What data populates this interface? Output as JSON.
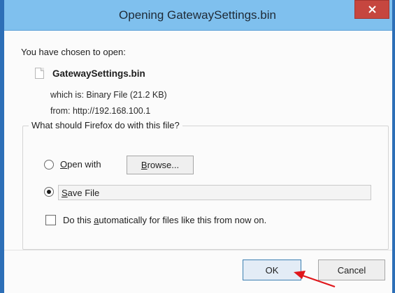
{
  "dialog": {
    "title": "Opening GatewaySettings.bin",
    "close_icon": "close-icon",
    "intro": "You have chosen to open:",
    "file": {
      "icon": "file-icon",
      "name": "GatewaySettings.bin",
      "type_line": "which is: Binary File (21.2 KB)",
      "from_line": "from: http://192.168.100.1"
    },
    "action_group": {
      "legend": "What should Firefox do with this file?",
      "open_with": {
        "label_accel": "O",
        "label_rest": "pen with",
        "checked": false
      },
      "browse_button": {
        "label_accel": "B",
        "label_rest": "rowse..."
      },
      "save_file": {
        "label_accel": "S",
        "label_rest": "ave File",
        "checked": true
      },
      "auto_checkbox": {
        "label_before": "Do this ",
        "label_accel": "a",
        "label_after": "utomatically for files like this from now on.",
        "checked": false
      }
    },
    "buttons": {
      "ok": "OK",
      "cancel": "Cancel"
    }
  },
  "colors": {
    "titlebar": "#7fc0ee",
    "close_button": "#c6463f",
    "window_border": "#2d6fb7",
    "annotation_arrow": "#e0161b"
  },
  "annotation": {
    "icon": "red-arrow-icon"
  }
}
